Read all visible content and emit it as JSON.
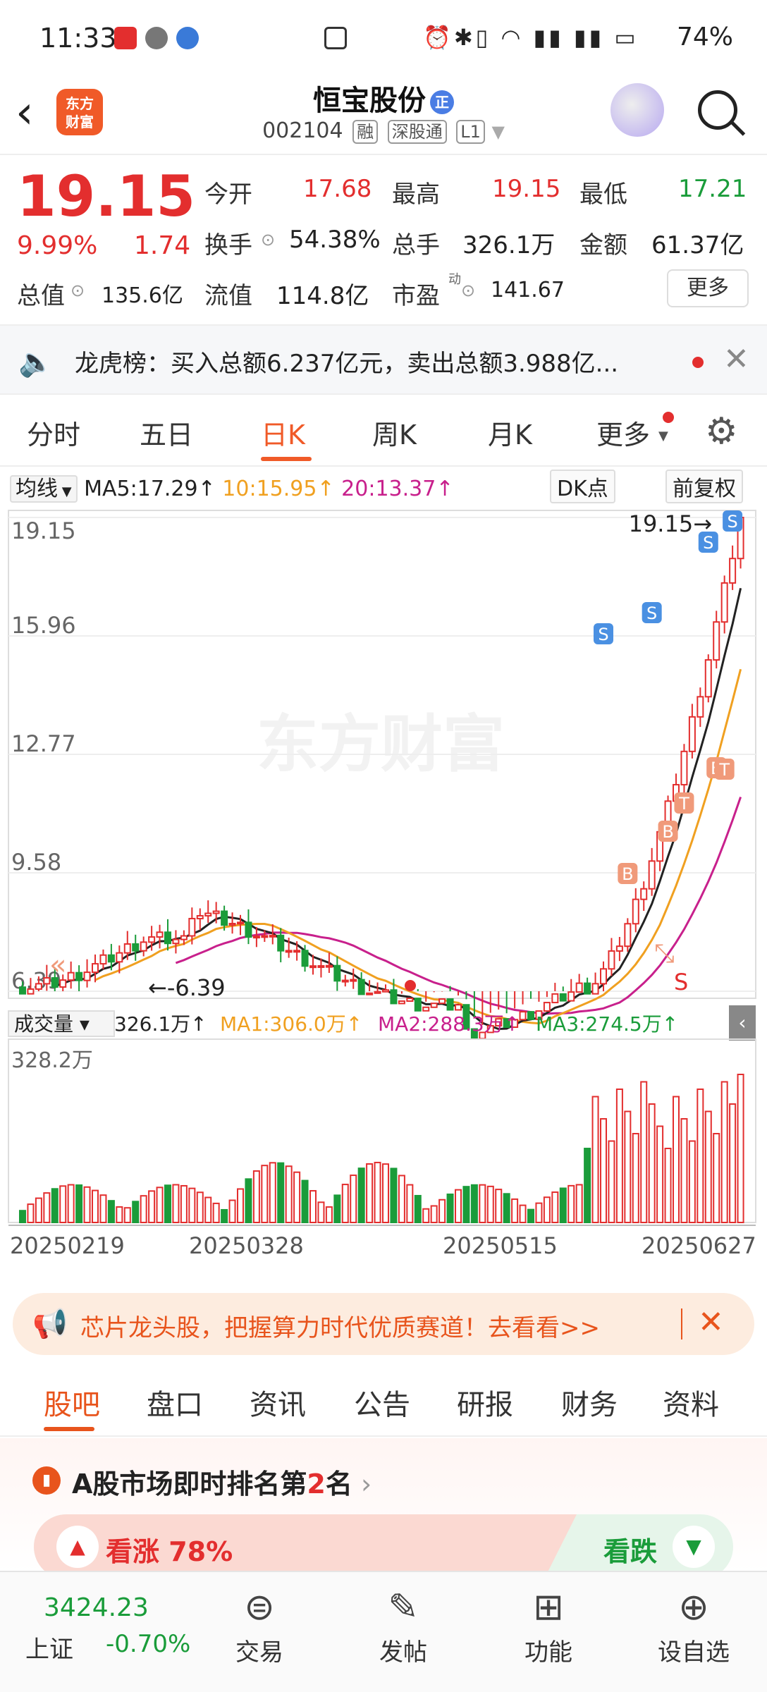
{
  "status_bar": {
    "time": "11:33",
    "battery": "74%",
    "right_icons": [
      "alarm-icon",
      "bluetooth-icon",
      "vibrate-icon",
      "wifi-icon",
      "signal-4g-icon",
      "signal-4g-icon",
      "battery-icon"
    ]
  },
  "header": {
    "stock_name": "恒宝股份",
    "badge": "正",
    "code": "002104",
    "tags": [
      "融",
      "深股通",
      "L1"
    ],
    "logo_text": "东方财富"
  },
  "quote": {
    "price": "19.15",
    "change_pct": "9.99%",
    "change_amt": "1.74",
    "fields": [
      {
        "label": "今开",
        "value": "17.68",
        "color": "red"
      },
      {
        "label": "最高",
        "value": "19.15",
        "color": "red"
      },
      {
        "label": "最低",
        "value": "17.21",
        "color": "green"
      },
      {
        "label": "换手",
        "value": "54.38%",
        "color": "dark"
      },
      {
        "label": "总手",
        "value": "326.1万",
        "color": "dark"
      },
      {
        "label": "金额",
        "value": "61.37亿",
        "color": "dark"
      },
      {
        "label": "总值",
        "value": "135.6亿",
        "color": "dark"
      },
      {
        "label": "流值",
        "value": "114.8亿",
        "color": "dark"
      },
      {
        "label": "市盈",
        "value": "141.67",
        "color": "dark",
        "sup": "动"
      }
    ],
    "more_button": "更多"
  },
  "lhb": {
    "text": "龙虎榜：买入总额6.237亿元，卖出总额3.988亿..."
  },
  "tabs": {
    "items": [
      "分时",
      "五日",
      "日K",
      "周K",
      "月K",
      "更多"
    ],
    "active": "日K"
  },
  "chart_header": {
    "ma_select": "均线",
    "ma5": "MA5:17.29↑",
    "ma10": "10:15.95↑",
    "ma20": "20:13.37↑",
    "dk": "DK点",
    "fq": "前复权"
  },
  "chart_data": {
    "type": "candlestick",
    "ylim": [
      6.39,
      19.15
    ],
    "y_ticks": [
      "19.15",
      "15.96",
      "12.77",
      "9.58",
      "6.39"
    ],
    "high_label": "19.15",
    "low_label": "6.39",
    "x_ticks": [
      "20250219",
      "20250328",
      "20250515",
      "20250627"
    ],
    "watermark": "东方财富",
    "volume": {
      "select": "成交量",
      "value": "326.1万↑",
      "ma1": "MA1:306.0万↑",
      "ma2": "MA2:288.3万↑",
      "ma3": "MA3:274.5万↑",
      "ymax_label": "328.2万"
    },
    "colors": {
      "up": "#e32e2e",
      "down": "#1a9c3a",
      "ma5": "#222222",
      "ma10": "#f0a020",
      "ma20": "#c8208c"
    }
  },
  "banner": {
    "text": "芯片龙头股，把握算力时代优质赛道！去看看>>"
  },
  "bottom_tabs": {
    "items": [
      "股吧",
      "盘口",
      "资讯",
      "公告",
      "研报",
      "财务",
      "资料"
    ],
    "active": "股吧"
  },
  "rank": {
    "prefix": "A股市场即时排名第",
    "rank": "2",
    "suffix": "名",
    "up_label": "看涨 78%",
    "down_label": "看跌",
    "up_pct": 78
  },
  "bottom_nav": {
    "index_value": "3424.23",
    "index_name": "上证",
    "index_change": "-0.70%",
    "items": [
      {
        "icon": "trade-icon",
        "label": "交易"
      },
      {
        "icon": "post-icon",
        "label": "发帖"
      },
      {
        "icon": "function-icon",
        "label": "功能"
      },
      {
        "icon": "add-watchlist-icon",
        "label": "设自选"
      }
    ]
  }
}
